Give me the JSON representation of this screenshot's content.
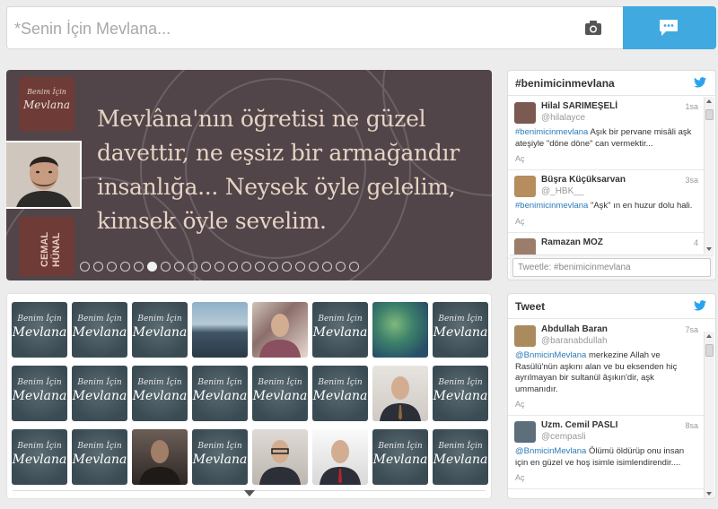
{
  "top_bar": {
    "input_placeholder": "*Senin İçin Mevlana..."
  },
  "slider": {
    "logo_line1": "Benim İçin",
    "logo_line2": "Mevlana",
    "person_name_line1": "CEMAL",
    "person_name_line2": "HÜNAL",
    "quote_lines": [
      "Mevlâna'nın öğretisi ne güzel",
      "davettir, ne eşsiz bir armağandır",
      "insanlığa... Neysek öyle gelelim,",
      "kimsek öyle sevelim."
    ],
    "dot_count": 21,
    "active_dot": 5
  },
  "grid": {
    "logo_line1": "Benim İçin",
    "logo_line2": "Mevlana",
    "tiles": [
      "logo",
      "logo",
      "logo",
      "sea",
      "bed",
      "logo",
      "leaf",
      "logo",
      "logo",
      "logo",
      "logo",
      "logo",
      "logo",
      "logo",
      "suit",
      "logo",
      "logo",
      "logo",
      "dark",
      "logo",
      "glasses",
      "suit2",
      "logo",
      "logo"
    ]
  },
  "widget_hashtag": {
    "title": "#benimicinmevlana",
    "compose_placeholder": "Tweetle: #benimicinmevlana",
    "tweets": [
      {
        "name": "Hilal SARIMEŞELİ",
        "handle": "@hilalayce",
        "time": "1sa",
        "hashtag": "#benimicinmevlana",
        "text": " Aşık bir pervane misâli aşk ateşiyle \"döne döne\" can vermektir...",
        "action": "Aç",
        "avatar_color": "#7b5a52"
      },
      {
        "name": "Büşra Küçüksarvan",
        "handle": "@_HBK__",
        "time": "3sa",
        "hashtag": "#benimicinmevlana",
        "text": "  \"Aşk\" ın en huzur dolu hali.",
        "action": "Aç",
        "avatar_color": "#b58d5f"
      },
      {
        "name": "Ramazan MOZ",
        "handle": "",
        "time": "4",
        "hashtag": "",
        "text": "",
        "action": "",
        "avatar_color": "#9a7d6a"
      }
    ]
  },
  "widget_tweet": {
    "title": "Tweet",
    "tweets": [
      {
        "name": "Abdullah Baran",
        "handle": "@baranabdullah",
        "time": "7sa",
        "hashtag": "@BnmicinMevlana",
        "text": " merkezine Allah ve Rasülü'nün aşkını alan ve bu eksenden hiç ayrılmayan bir sultanül âşıkın'dir, aşk ummanıdır.",
        "action": "Aç",
        "avatar_color": "#a98b5e"
      },
      {
        "name": "Uzm. Cemil PASLI",
        "handle": "@cempasli",
        "time": "8sa",
        "hashtag": "@BnmicinMevlana",
        "text": " Ölümü öldürüp onu insan için en güzel ve hoş isimle isimlendirendir....",
        "action": "Aç",
        "avatar_color": "#5e6f7c"
      }
    ]
  }
}
